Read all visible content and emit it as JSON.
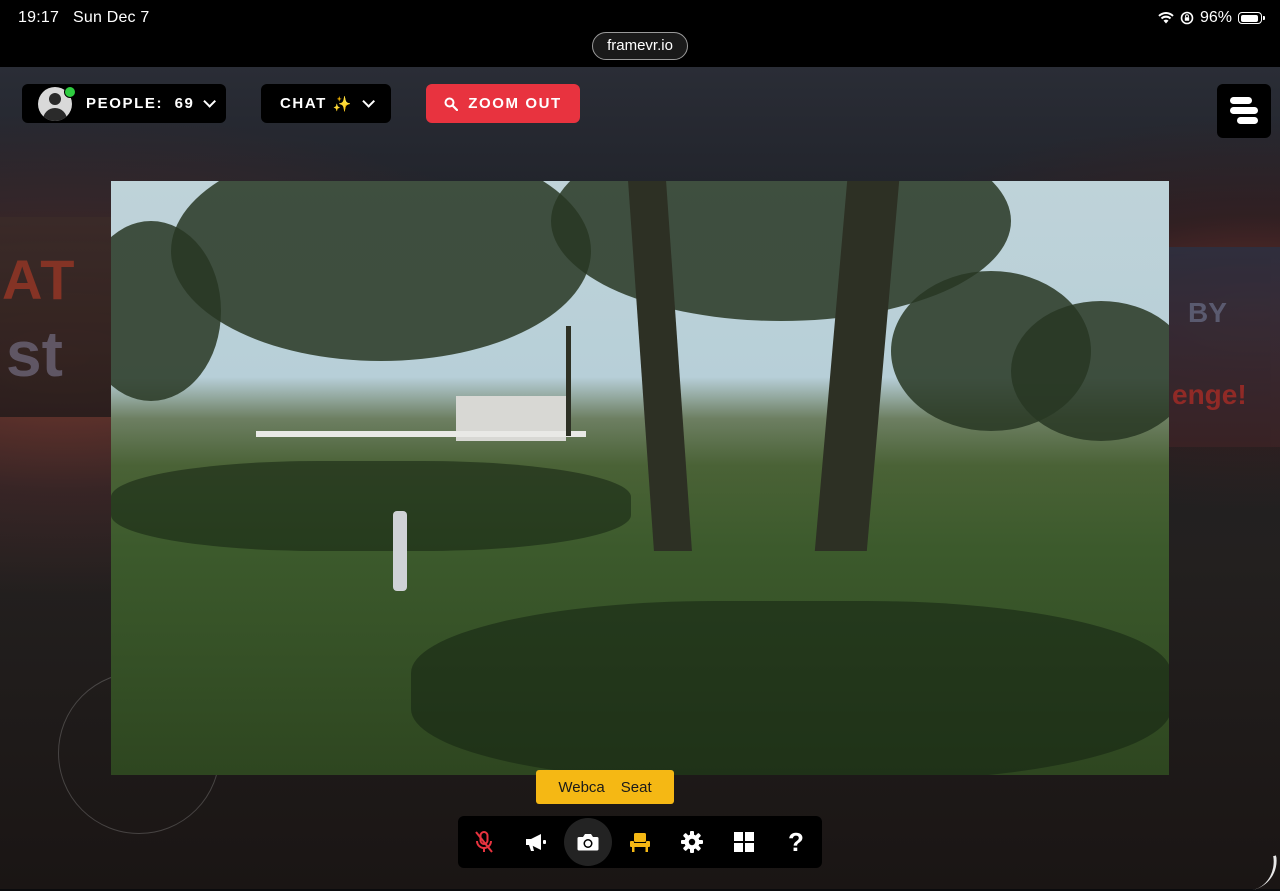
{
  "status_bar": {
    "time": "19:17",
    "date": "Sun Dec 7",
    "battery": "96%",
    "battery_level": 0.96,
    "url": "framevr.io"
  },
  "scene": {
    "sign_left_top": "AT",
    "sign_left_bottom": "st",
    "sign_right_top": "BY",
    "sign_right_bottom": "enge!"
  },
  "top_controls": {
    "people_label": "PEOPLE:",
    "people_count": "69",
    "chat_label": "CHAT",
    "chat_emoji": "✨",
    "zoom_label": "ZOOM OUT"
  },
  "tooltip": {
    "webcam_label": "Webca",
    "seat_label": "Seat"
  },
  "toolbar": {
    "items": [
      "mic-muted-icon",
      "megaphone-icon",
      "camera-icon",
      "seat-icon",
      "gear-icon",
      "grid-icon",
      "help-icon"
    ],
    "help_label": "?"
  },
  "colors": {
    "zoom_button": "#e8333f",
    "tooltip": "#f5b814",
    "mic_muted": "#e8333f",
    "seat_active": "#f5b814",
    "online": "#2ecc40"
  }
}
